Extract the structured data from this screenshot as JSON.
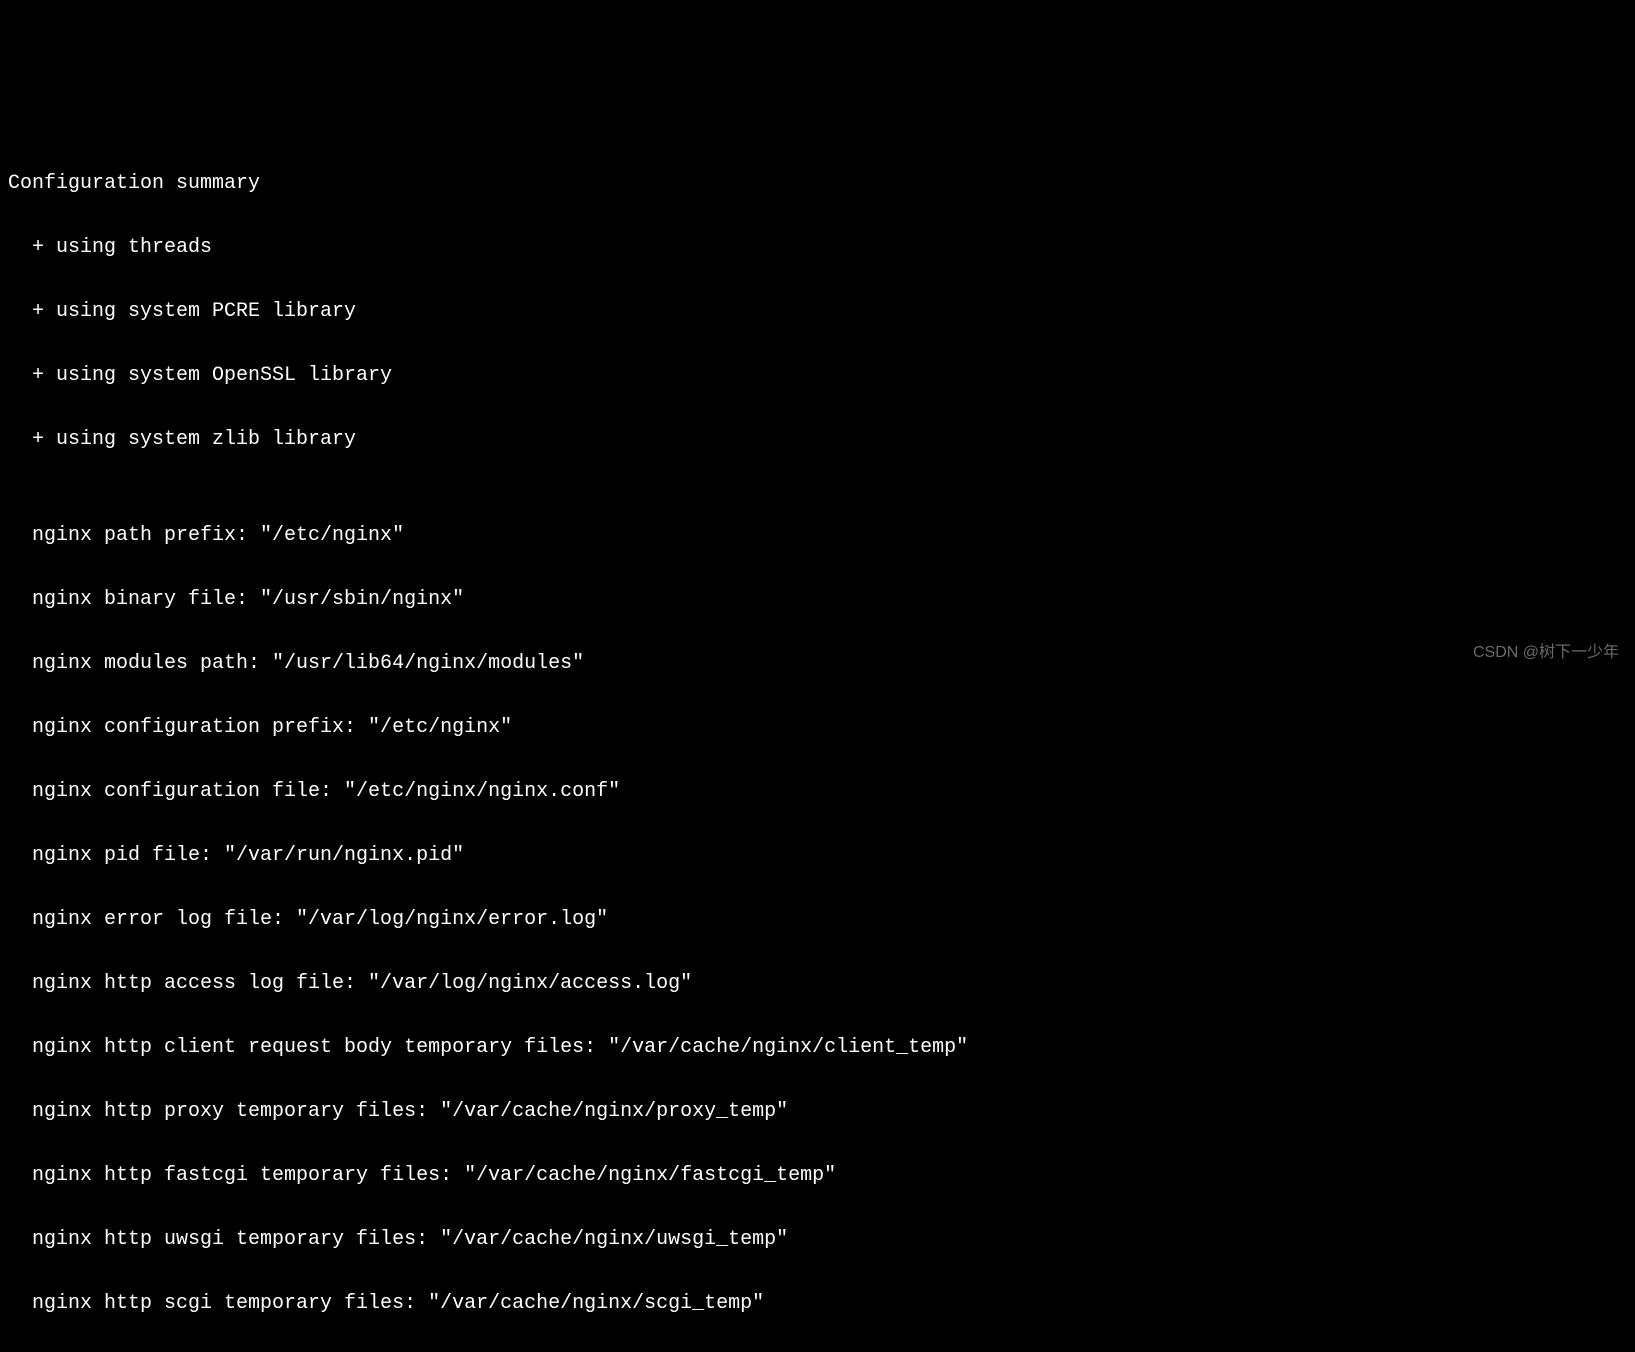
{
  "terminal": {
    "header": "Configuration summary",
    "features": [
      "  + using threads",
      "  + using system PCRE library",
      "  + using system OpenSSL library",
      "  + using system zlib library"
    ],
    "blank": "",
    "paths": [
      "  nginx path prefix: \"/etc/nginx\"",
      "  nginx binary file: \"/usr/sbin/nginx\"",
      "  nginx modules path: \"/usr/lib64/nginx/modules\"",
      "  nginx configuration prefix: \"/etc/nginx\"",
      "  nginx configuration file: \"/etc/nginx/nginx.conf\"",
      "  nginx pid file: \"/var/run/nginx.pid\"",
      "  nginx error log file: \"/var/log/nginx/error.log\"",
      "  nginx http access log file: \"/var/log/nginx/access.log\"",
      "  nginx http client request body temporary files: \"/var/cache/nginx/client_temp\"",
      "  nginx http proxy temporary files: \"/var/cache/nginx/proxy_temp\"",
      "  nginx http fastcgi temporary files: \"/var/cache/nginx/fastcgi_temp\"",
      "  nginx http uwsgi temporary files: \"/var/cache/nginx/uwsgi_temp\"",
      "  nginx http scgi temporary files: \"/var/cache/nginx/scgi_temp\""
    ]
  },
  "watermark": "CSDN @树下一少年"
}
